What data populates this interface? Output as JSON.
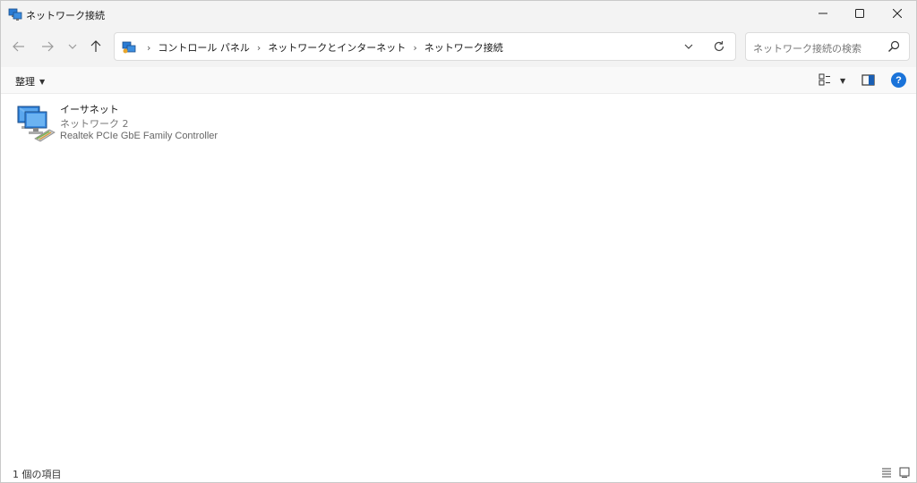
{
  "window": {
    "title": "ネットワーク接続",
    "controls": {
      "minimize_icon": "minimize-icon",
      "maximize_icon": "maximize-icon",
      "close_icon": "close-icon"
    }
  },
  "nav": {
    "icons": [
      "back-arrow-icon",
      "forward-arrow-icon",
      "chevron-down-icon",
      "up-arrow-icon"
    ],
    "breadcrumbs": [
      "コントロール パネル",
      "ネットワークとインターネット",
      "ネットワーク接続"
    ],
    "search_placeholder": "ネットワーク接続の検索"
  },
  "commandbar": {
    "organize_label": "整理",
    "help_label": "?"
  },
  "items": [
    {
      "name": "イーサネット",
      "network": "ネットワーク 2",
      "adapter": "Realtek PCIe GbE Family Controller"
    }
  ],
  "status": {
    "count_text": "1 個の項目"
  },
  "colors": {
    "titlebar_bg": "#f3f3f3",
    "help_blue": "#1a73d9"
  }
}
